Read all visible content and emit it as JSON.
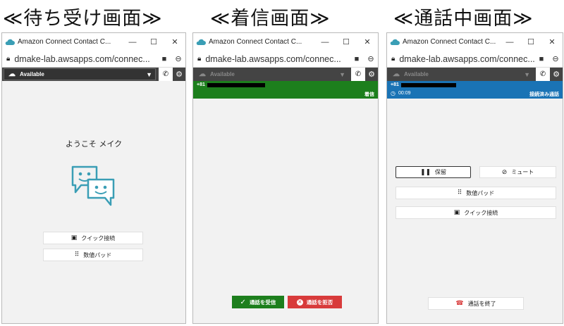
{
  "headings": [
    "≪待ち受け画面≫",
    "≪着信画面≫",
    "≪通話中画面≫"
  ],
  "window": {
    "title": "Amazon Connect Contact C...",
    "url": "dmake-lab.awsapps.com/connec..."
  },
  "status": {
    "label": "Available"
  },
  "idle": {
    "welcome": "ようこそ メイク",
    "quick_connect": "クイック接続",
    "numpad": "数値パッド"
  },
  "incoming": {
    "number": "+81",
    "status": "着信",
    "accept": "通話を受信",
    "reject": "通話を拒否"
  },
  "oncall": {
    "number": "+81",
    "timer": "00:09",
    "status": "接続済み通話",
    "hold": "保留",
    "mute": "ミュート",
    "numpad": "数値パッド",
    "quick_connect": "クイック接続",
    "end_call": "通話を終了"
  },
  "colors": {
    "incoming_banner": "#1d7f1d",
    "connected_banner": "#1a73b5",
    "reject_red": "#d83b3b",
    "accept_green": "#1d7f1d",
    "brand_teal": "#3a9eb5"
  },
  "icons": [
    "cloud-icon",
    "minimize-icon",
    "maximize-icon",
    "close-icon",
    "lock-icon",
    "camera-icon",
    "zoom-icon",
    "chevron-down-icon",
    "phone-icon",
    "gear-icon",
    "chatbot-icon",
    "quick-connect-icon",
    "numpad-icon",
    "check-icon",
    "reject-icon",
    "clock-icon",
    "pause-icon",
    "mic-off-icon",
    "end-call-icon"
  ]
}
